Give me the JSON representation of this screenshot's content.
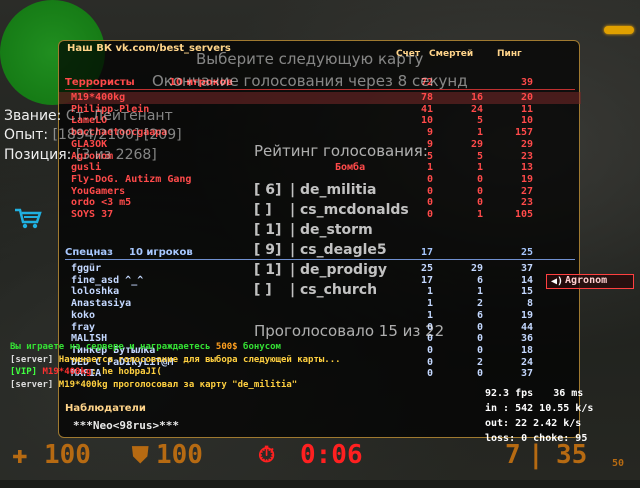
{
  "scoreboard": {
    "title": "Наш ВК vk.com/best_servers",
    "headers": {
      "score": "Счет",
      "deaths": "Смертей",
      "ping": "Пинг"
    },
    "terrorists": {
      "label": "Террористы",
      "count": "10 игроков",
      "score": "72",
      "ping": "39"
    },
    "terrorists_rows": [
      {
        "name": "M19*400kg",
        "tag": "",
        "score": "78",
        "deaths": "16",
        "ping": "20"
      },
      {
        "name": "Philipp Plein",
        "tag": "",
        "score": "41",
        "deaths": "24",
        "ping": "11"
      },
      {
        "name": "LameLO",
        "tag": "",
        "score": "10",
        "deaths": "5",
        "ping": "10"
      },
      {
        "name": "bacchaetoocgaapa",
        "tag": "",
        "score": "9",
        "deaths": "1",
        "ping": "157"
      },
      {
        "name": "GLA3OK",
        "tag": "",
        "score": "9",
        "deaths": "29",
        "ping": "29"
      },
      {
        "name": "Agronom",
        "tag": "",
        "score": "5",
        "deaths": "5",
        "ping": "23"
      },
      {
        "name": "gusli",
        "tag": "Бомба",
        "score": "1",
        "deaths": "1",
        "ping": "13"
      },
      {
        "name": "Fly-DoG. Autizm Gang",
        "tag": "",
        "score": "0",
        "deaths": "0",
        "ping": "19"
      },
      {
        "name": "YouGamers",
        "tag": "",
        "score": "0",
        "deaths": "0",
        "ping": "27"
      },
      {
        "name": "ordo <3 m5",
        "tag": "",
        "score": "0",
        "deaths": "0",
        "ping": "23"
      },
      {
        "name": "SOYS 37",
        "tag": "",
        "score": "0",
        "deaths": "1",
        "ping": "105"
      }
    ],
    "ct": {
      "label": "Спецназ",
      "count": "10 игроков",
      "score": "17",
      "ping": "25"
    },
    "ct_rows": [
      {
        "name": "fggür",
        "score": "25",
        "deaths": "29",
        "ping": "37"
      },
      {
        "name": "fine_asd ^_^",
        "score": "17",
        "deaths": "6",
        "ping": "14"
      },
      {
        "name": "loloshka",
        "score": "1",
        "deaths": "1",
        "ping": "15"
      },
      {
        "name": "Anastasiya",
        "score": "1",
        "deaths": "2",
        "ping": "8"
      },
      {
        "name": "koko",
        "score": "1",
        "deaths": "6",
        "ping": "19"
      },
      {
        "name": "fray",
        "score": "0",
        "deaths": "0",
        "ping": "44"
      },
      {
        "name": "MALISH",
        "score": "0",
        "deaths": "0",
        "ping": "36"
      },
      {
        "name": "Тинкер Бутылка",
        "score": "0",
        "deaths": "0",
        "ping": "18"
      },
      {
        "name": "DED C PaDIkyLiT@M",
        "score": "0",
        "deaths": "2",
        "ping": "24"
      },
      {
        "name": "MAFIA",
        "score": "0",
        "deaths": "0",
        "ping": "37"
      }
    ],
    "spectators": {
      "label": "Наблюдатели",
      "name": "***Neo<98rus>***"
    }
  },
  "vote": {
    "header": "Выберите следующую карту",
    "countdown": "Окончание голосования через 8 секунд",
    "rating_title": "Рейтинг голосования:",
    "options": [
      {
        "count": "[ 6]",
        "map": "de_militia"
      },
      {
        "count": "[   ]",
        "map": "cs_mcdonalds"
      },
      {
        "count": "[ 1]",
        "map": "de_storm"
      },
      {
        "count": "[ 9]",
        "map": "cs_deagle5"
      },
      {
        "count": "[ 1]",
        "map": "de_prodigy"
      },
      {
        "count": "[   ]",
        "map": "cs_church"
      }
    ],
    "voted": "Проголосовало 15 из 22"
  },
  "rank": {
    "title_label": "Звание:",
    "title_value": "Ст. Лейтенант",
    "exp_label": "Опыт:",
    "exp_value": "[1894/2100] [209]",
    "pos_label": "Позиция:",
    "pos_value": "[3 из 2268]"
  },
  "chat": {
    "line1_a": "Вы играете на сервере",
    "line1_b": "и награждаетесь",
    "line1_bonus": "500$",
    "line1_c": "бонусом",
    "line2_tag": "[server]",
    "line2_text": "Начинается голосование для выбора следующей карты...",
    "line3_tag": "[VIP]",
    "line3_name": "M19*400kg",
    "line3_text": ": he hobpaJI(",
    "line4_tag": "[server]",
    "line4_text": "M19*400kg проголосовал за карту \"de_militia\""
  },
  "net": {
    "fps": "92.3 fps",
    "ms": "36 ms",
    "in": "in :  542 10.55 k/s",
    "out": "out:  22 2.42 k/s",
    "loss": "loss: 0 choke:  95"
  },
  "killfeed": {
    "name": "Agronom"
  },
  "hud": {
    "health": "100",
    "armor": "100",
    "timer": "0:06",
    "ammo_clip": "7",
    "ammo_sep": "|",
    "ammo_reserve": "35",
    "ammo_small": "50"
  },
  "colors": {
    "t": "#ff4a4a",
    "ct": "#a8c8ff",
    "hud": "#b66a12",
    "border": "#a07a30"
  }
}
